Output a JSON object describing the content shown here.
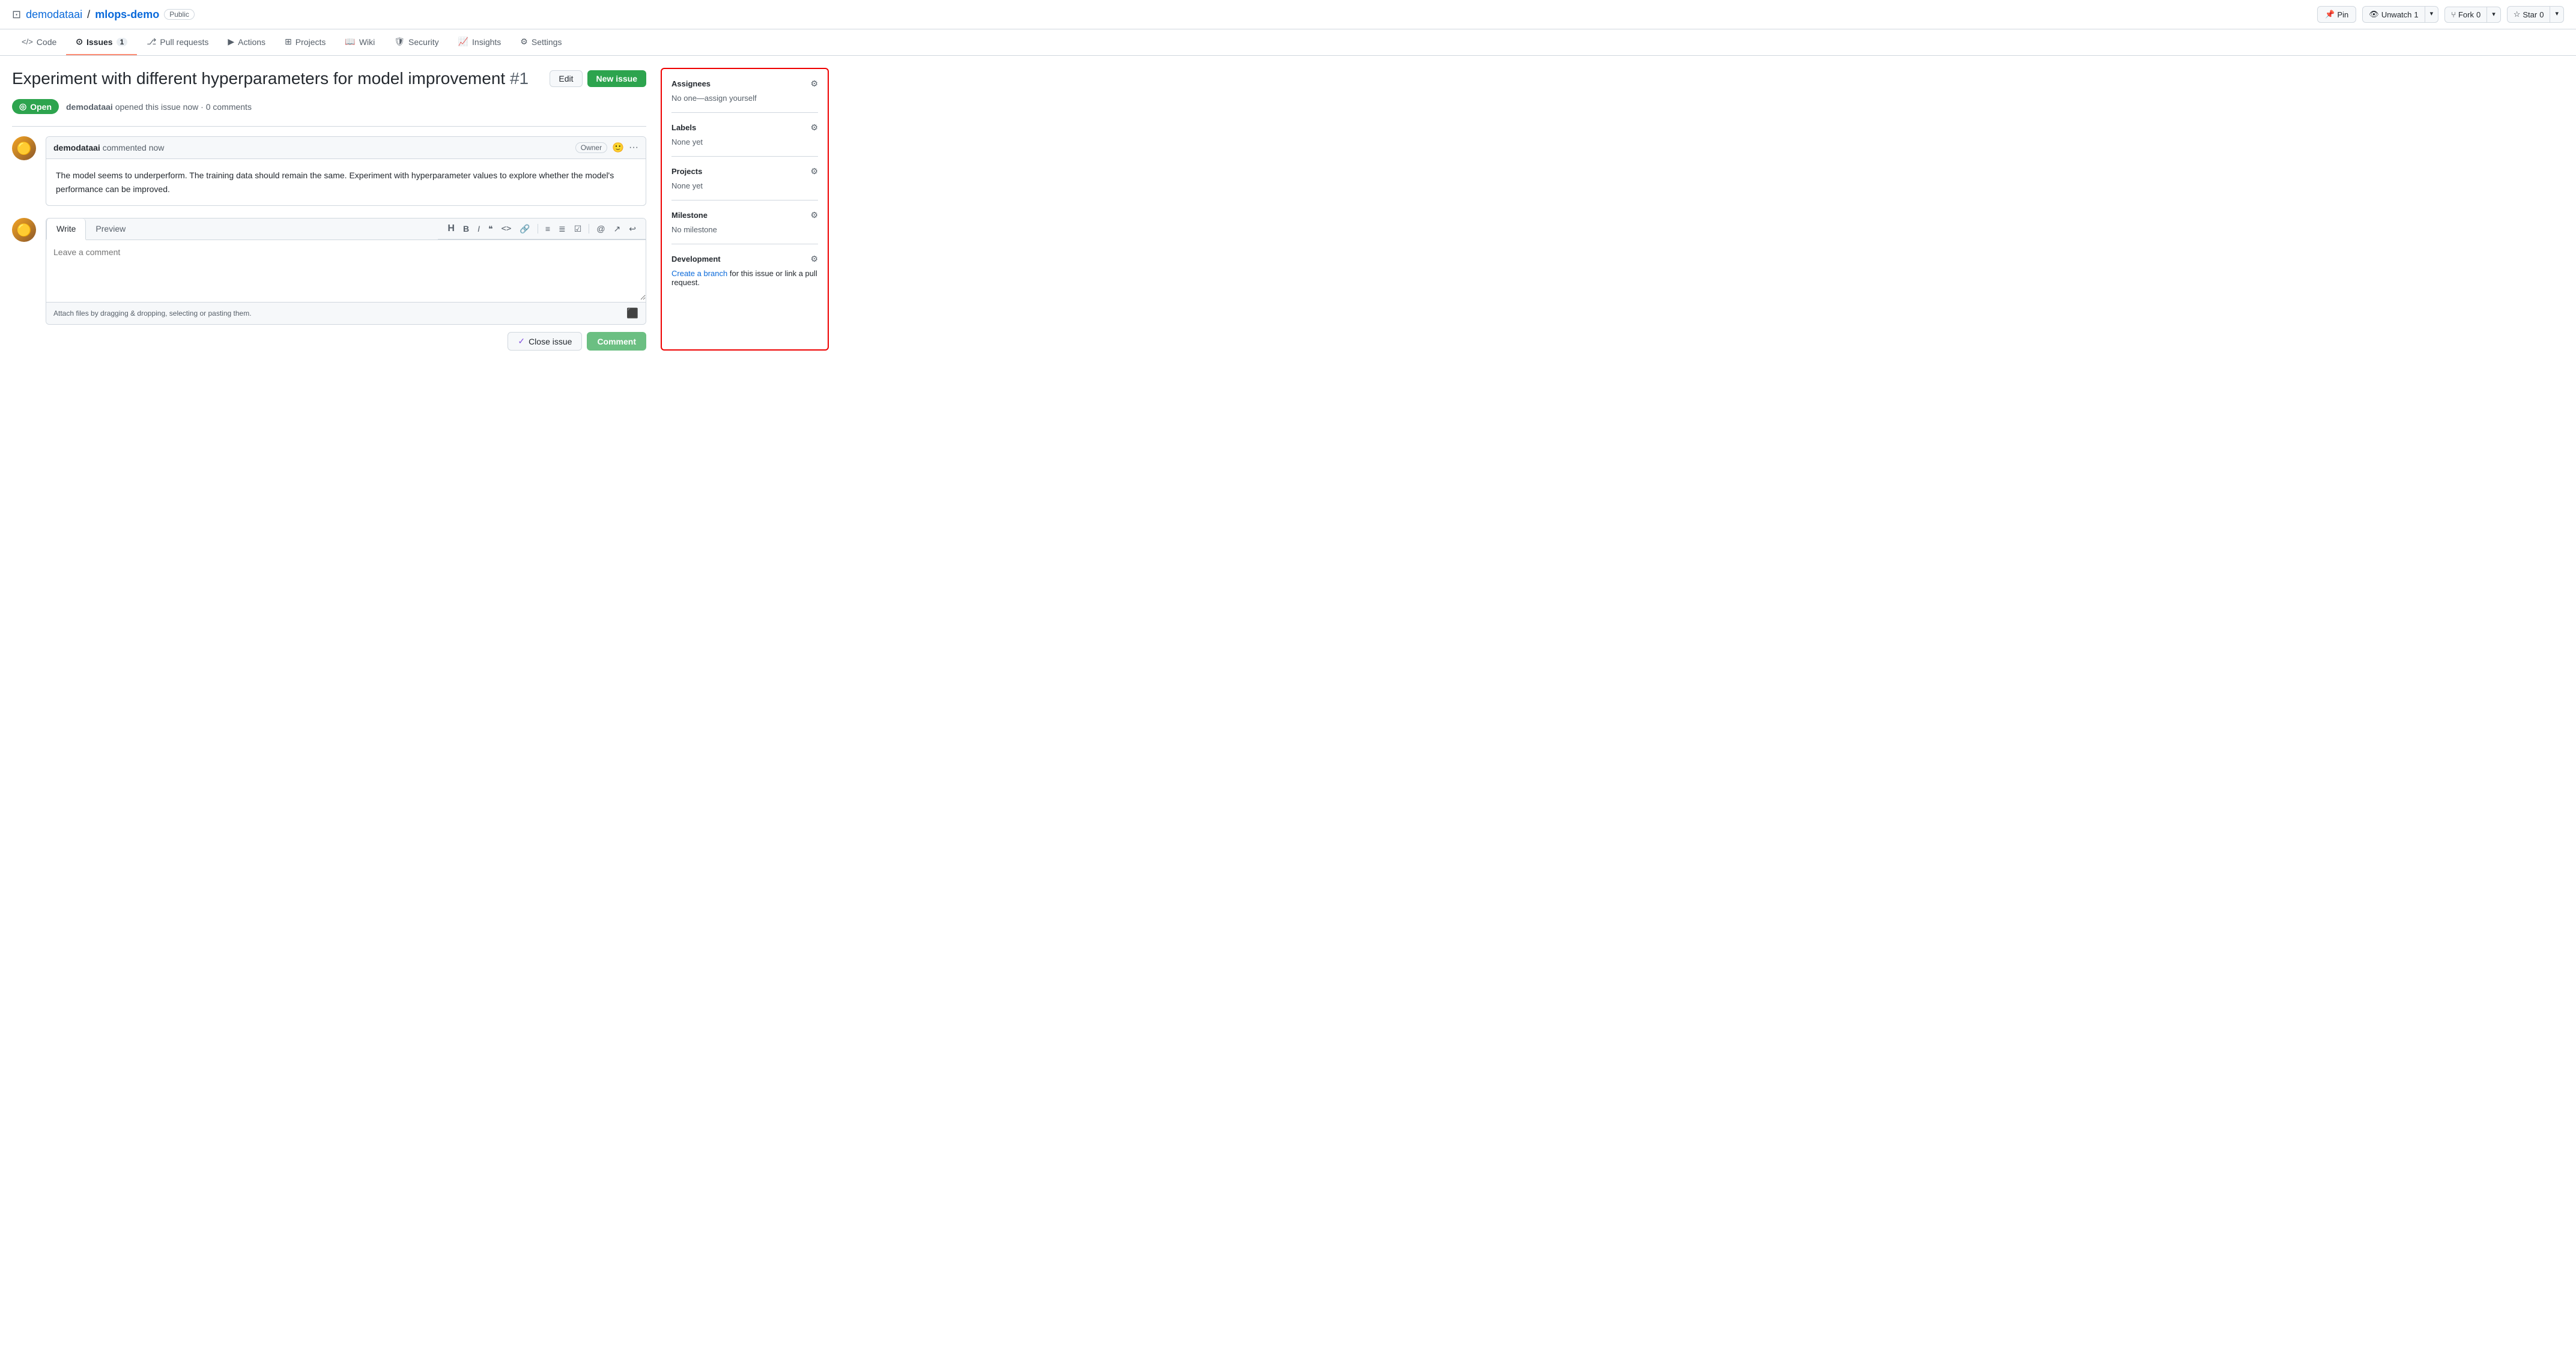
{
  "repo": {
    "owner": "demodataai",
    "name": "mlops-demo",
    "visibility": "Public",
    "repo_icon": "⊡"
  },
  "top_actions": {
    "pin_label": "Pin",
    "unwatch_label": "Unwatch",
    "unwatch_count": "1",
    "fork_label": "Fork",
    "fork_count": "0",
    "star_label": "Star",
    "star_count": "0"
  },
  "nav": {
    "tabs": [
      {
        "id": "code",
        "label": "Code",
        "badge": null,
        "active": false
      },
      {
        "id": "issues",
        "label": "Issues",
        "badge": "1",
        "active": true
      },
      {
        "id": "pull-requests",
        "label": "Pull requests",
        "badge": null,
        "active": false
      },
      {
        "id": "actions",
        "label": "Actions",
        "badge": null,
        "active": false
      },
      {
        "id": "projects",
        "label": "Projects",
        "badge": null,
        "active": false
      },
      {
        "id": "wiki",
        "label": "Wiki",
        "badge": null,
        "active": false
      },
      {
        "id": "security",
        "label": "Security",
        "badge": null,
        "active": false
      },
      {
        "id": "insights",
        "label": "Insights",
        "badge": null,
        "active": false
      },
      {
        "id": "settings",
        "label": "Settings",
        "badge": null,
        "active": false
      }
    ]
  },
  "issue": {
    "title": "Experiment with different hyperparameters for model improvement",
    "number": "#1",
    "status": "Open",
    "author": "demodataai",
    "time": "now",
    "comments": "0 comments",
    "edit_label": "Edit",
    "new_issue_label": "New issue"
  },
  "comment": {
    "author": "demodataai",
    "action": "commented now",
    "owner_badge": "Owner",
    "body": "The model seems to underperform. The training data should remain the same. Experiment with hyperparameter values to explore whether the model's performance can be improved."
  },
  "write_area": {
    "write_tab": "Write",
    "preview_tab": "Preview",
    "placeholder": "Leave a comment",
    "attach_text": "Attach files by dragging & dropping, selecting or pasting them.",
    "close_issue_label": "Close issue",
    "comment_label": "Comment",
    "toolbar": {
      "h": "H",
      "bold": "B",
      "italic": "I",
      "quote": "❝",
      "code": "<>",
      "link": "🔗",
      "bullet": "≡",
      "numbered": "≣",
      "task": "☑",
      "mention": "@",
      "ref": "↗",
      "undo": "↩"
    }
  },
  "sidebar": {
    "assignees": {
      "title": "Assignees",
      "value": "No one—assign yourself"
    },
    "labels": {
      "title": "Labels",
      "value": "None yet"
    },
    "projects": {
      "title": "Projects",
      "value": "None yet"
    },
    "milestone": {
      "title": "Milestone",
      "value": "No milestone"
    },
    "development": {
      "title": "Development",
      "link_text": "Create a branch",
      "suffix": " for this issue or link a pull request."
    }
  }
}
